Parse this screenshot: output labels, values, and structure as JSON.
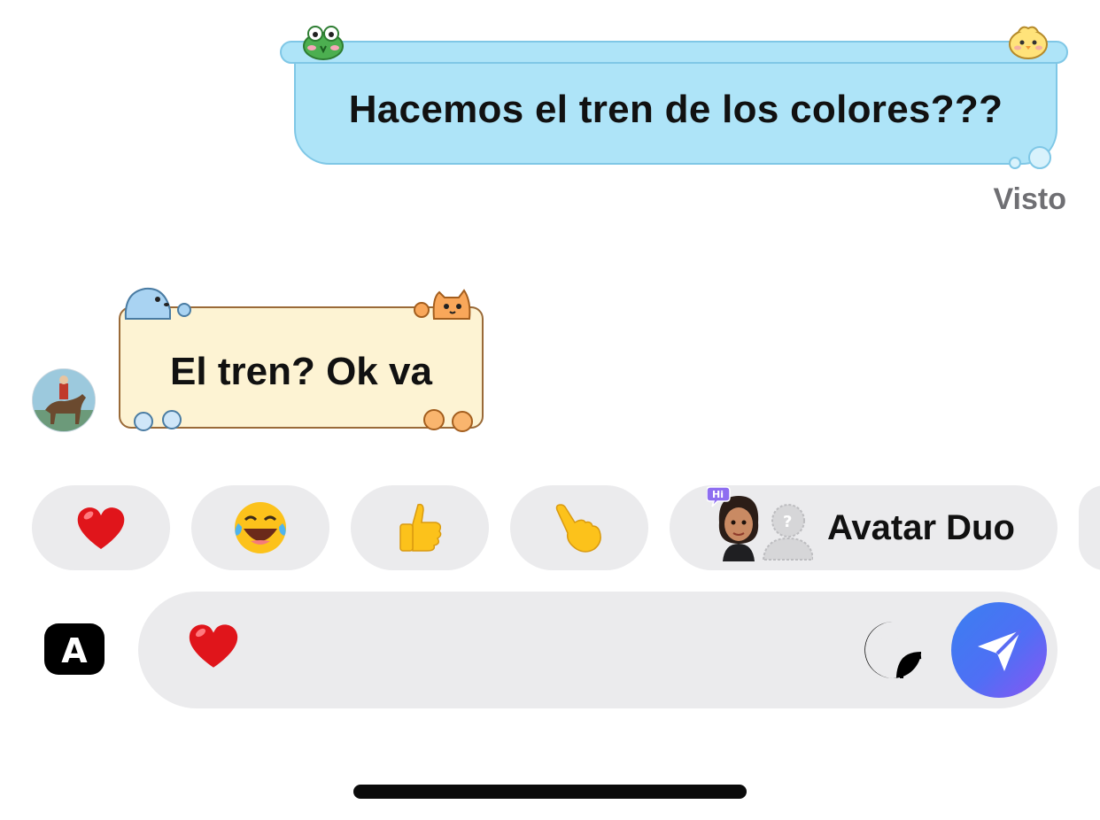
{
  "thread": {
    "outgoing_message": "Hacemos el tren de los colores???",
    "seen_status": "Visto",
    "incoming_message": "El tren? Ok va"
  },
  "quick_reactions": {
    "items": [
      {
        "icon": "heart-icon"
      },
      {
        "icon": "laughing-crying-face-icon"
      },
      {
        "icon": "thumbs-up-icon"
      },
      {
        "icon": "pointing-hand-icon"
      }
    ],
    "avatar_duo_label": "Avatar Duo",
    "avatar_duo_badge": "Hi"
  },
  "composer": {
    "current_value_icon": "heart-icon",
    "app_icon": "a-app-icon",
    "sticker_icon": "sticker-icon",
    "send_icon": "send-arrow-icon"
  },
  "colors": {
    "outgoing_bubble": "#aee4f8",
    "incoming_bubble": "#fdf3d3",
    "chip_bg": "#ebebed",
    "send_gradient_start": "#3a7ff0",
    "send_gradient_end": "#8a55f2",
    "seen_text": "#6f6f73"
  }
}
